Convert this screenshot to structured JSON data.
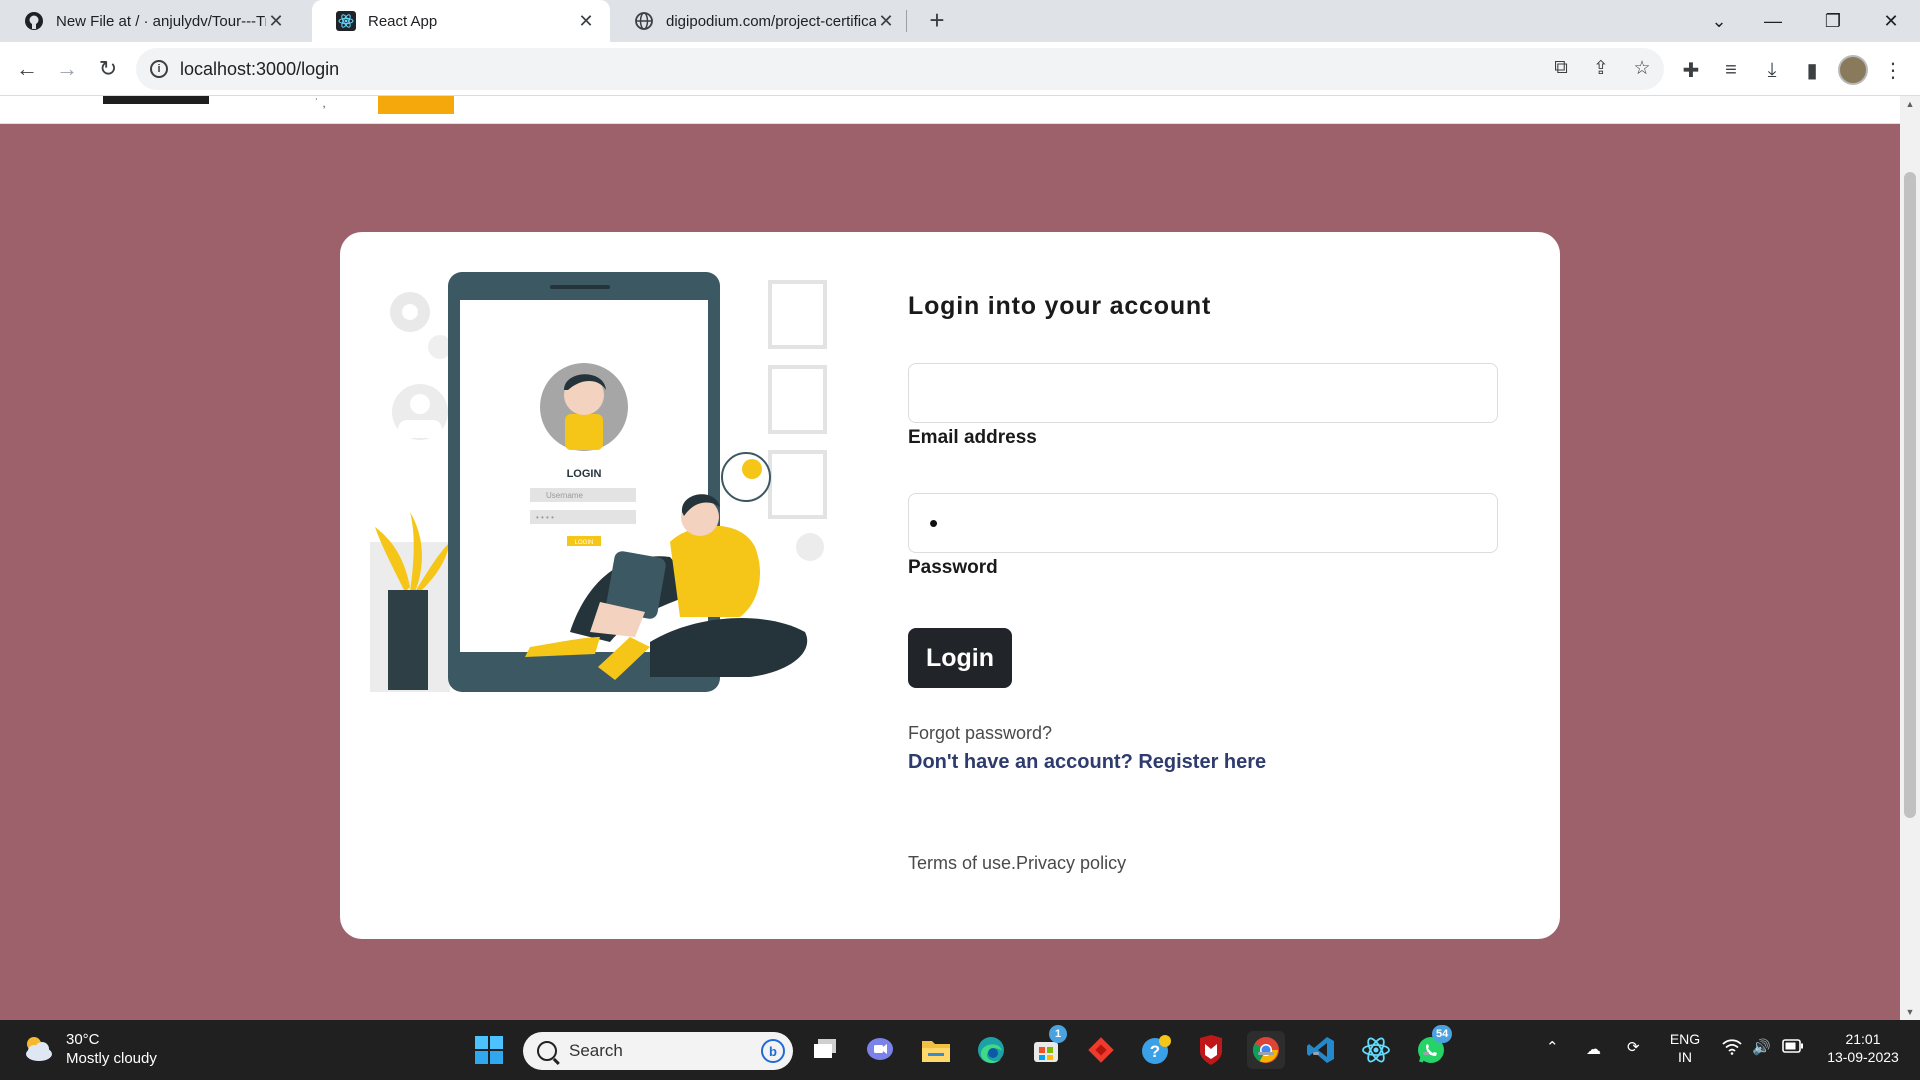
{
  "browser": {
    "tabs": [
      {
        "title": "New File at / · anjulydv/Tour---Tra",
        "icon": "github-icon"
      },
      {
        "title": "React App",
        "icon": "react-icon"
      },
      {
        "title": "digipodium.com/project-certifica",
        "icon": "globe-icon"
      }
    ],
    "url": "localhost:3000/login"
  },
  "page": {
    "form_title": "Login into your account",
    "email": {
      "label": "Email address",
      "value": ""
    },
    "password": {
      "label": "Password",
      "value": "•"
    },
    "login_button": "Login",
    "forgot_password": "Forgot password?",
    "register_link": "Don't have an account? Register here",
    "terms": "Terms of use.Privacy policy",
    "illustration": {
      "screen_label": "LOGIN",
      "username_placeholder": "Username",
      "password_mask": "• • • •",
      "button_text": "LOGIN"
    }
  },
  "taskbar": {
    "weather": {
      "temp": "30°C",
      "condition": "Mostly cloudy"
    },
    "search_placeholder": "Search",
    "badges": {
      "store": "1",
      "whatsapp": "54"
    },
    "language": {
      "line1": "ENG",
      "line2": "IN"
    },
    "clock": {
      "time": "21:01",
      "date": "13-09-2023"
    }
  },
  "colors": {
    "page_background": "#9d616b",
    "card_background": "#ffffff",
    "button_background": "#212529",
    "link_color": "#2e3b6e",
    "accent_yellow": "#f5c518",
    "nav_orange": "#f5a80c"
  }
}
